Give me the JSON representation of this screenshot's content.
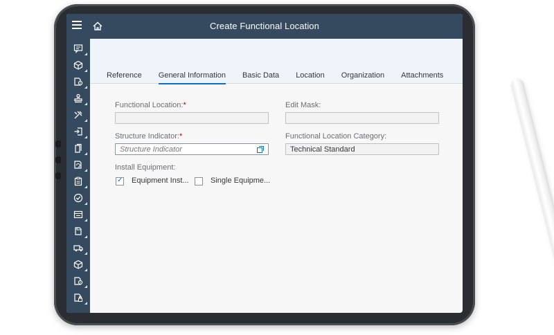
{
  "shell": {
    "title": "Create Functional Location"
  },
  "rail": {
    "items": [
      {
        "icon": "message-icon"
      },
      {
        "icon": "cube-icon"
      },
      {
        "icon": "document-settings-icon"
      },
      {
        "icon": "stamp-icon"
      },
      {
        "icon": "tools-icon"
      },
      {
        "icon": "insert-icon"
      },
      {
        "icon": "copy-icon"
      },
      {
        "icon": "refresh-document-icon"
      },
      {
        "icon": "clipboard-icon"
      },
      {
        "icon": "check-circle-icon"
      },
      {
        "icon": "form-icon"
      },
      {
        "icon": "document-icon"
      },
      {
        "icon": "truck-icon"
      },
      {
        "icon": "cube-icon"
      },
      {
        "icon": "document-settings-icon"
      },
      {
        "icon": "document-lock-icon"
      }
    ]
  },
  "tabs": [
    {
      "label": "Reference"
    },
    {
      "label": "General Information",
      "active": true
    },
    {
      "label": "Basic Data"
    },
    {
      "label": "Location"
    },
    {
      "label": "Organization"
    },
    {
      "label": "Attachments"
    }
  ],
  "form": {
    "functional_location": {
      "label": "Functional Location:",
      "required": "*",
      "value": ""
    },
    "edit_mask": {
      "label": "Edit Mask:",
      "value": ""
    },
    "structure_indicator": {
      "label": "Structure Indicator:",
      "required": "*",
      "placeholder": "Structure Indicator"
    },
    "category": {
      "label": "Functional Location Category:",
      "value": "Technical Standard"
    },
    "install_equipment": {
      "label": "Install Equipment:",
      "options": [
        {
          "label": "Equipment Inst...",
          "checked": true
        },
        {
          "label": "Single Equipme...",
          "checked": false
        }
      ]
    }
  },
  "colors": {
    "shell": "#354a5f",
    "accent": "#0a6ed1",
    "required": "#bb0000"
  }
}
